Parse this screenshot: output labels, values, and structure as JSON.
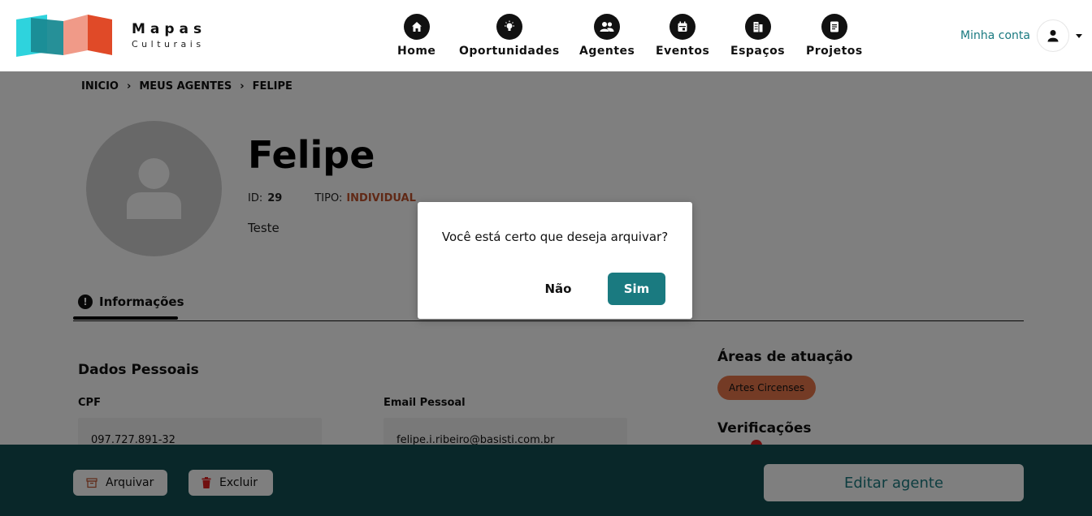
{
  "header": {
    "brand_line1": "Mapas",
    "brand_line2": "Culturais",
    "nav": [
      {
        "label": "Home",
        "icon": "home-icon"
      },
      {
        "label": "Oportunidades",
        "icon": "lightbulb-icon"
      },
      {
        "label": "Agentes",
        "icon": "people-icon"
      },
      {
        "label": "Eventos",
        "icon": "calendar-icon"
      },
      {
        "label": "Espaços",
        "icon": "building-icon"
      },
      {
        "label": "Projetos",
        "icon": "document-icon"
      }
    ],
    "account_label": "Minha conta",
    "account_icon": "user-icon"
  },
  "breadcrumb": [
    "INICIO",
    "MEUS AGENTES",
    "FELIPE"
  ],
  "agent": {
    "name": "Felipe",
    "id_label": "ID:",
    "id_value": "29",
    "type_label": "TIPO:",
    "type_value": "INDIVIDUAL",
    "description": "Teste"
  },
  "tabs": [
    {
      "label": "Informações",
      "icon": "info-icon"
    }
  ],
  "personal": {
    "title": "Dados Pessoais",
    "cpf_label": "CPF",
    "cpf_value": "097.727.891-32",
    "email_label": "Email Pessoal",
    "email_value": "felipe.i.ribeiro@basisti.com.br"
  },
  "sidebar": {
    "areas_title": "Áreas de atuação",
    "areas": [
      "Artes Circenses"
    ],
    "verif_title": "Verificações"
  },
  "footer": {
    "archive_label": "Arquivar",
    "delete_label": "Excluir",
    "edit_label": "Editar agente"
  },
  "modal": {
    "message": "Você está certo que deseja arquivar?",
    "no_label": "Não",
    "yes_label": "Sim"
  },
  "colors": {
    "accent": "#1a7a80",
    "footer_bg": "#124f53",
    "type_color": "#c0522c",
    "tag_bg": "#e8764b",
    "logo_teal_light": "#2ed3dd",
    "logo_teal_dark": "#1a8a92",
    "logo_salmon": "#f09a88",
    "logo_orange": "#e04a28"
  }
}
